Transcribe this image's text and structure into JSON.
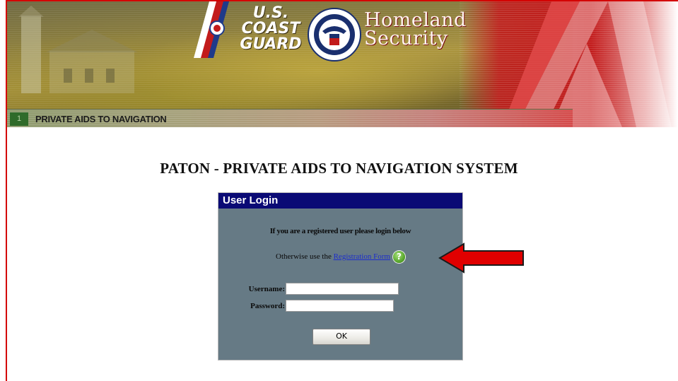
{
  "header": {
    "agency_line1": "U.S.",
    "agency_line2": "COAST",
    "agency_line3": "GUARD",
    "dept_line1": "Homeland",
    "dept_line2": "Security",
    "nav_number": "1",
    "nav_label": "PRIVATE AIDS TO NAVIGATION"
  },
  "title": "PATON - PRIVATE AIDS TO NAVIGATION SYSTEM",
  "login": {
    "header": "User Login",
    "intro": "If you are a registered user please login below",
    "registration_prefix": "Otherwise use the ",
    "registration_link": "Registration Form",
    "help_glyph": "?",
    "username_label": "Username:",
    "username_value": "",
    "password_label": "Password:",
    "password_value": "",
    "ok_label": "OK"
  },
  "colors": {
    "brand_red": "#c21b1b",
    "panel_bg": "#667a85",
    "panel_header": "#0a0a75",
    "link": "#1c2dcc",
    "arrow": "#e00000"
  },
  "icons": [
    "uscg-emblem-icon",
    "dhs-seal-icon",
    "help-icon",
    "red-arrow-icon"
  ]
}
